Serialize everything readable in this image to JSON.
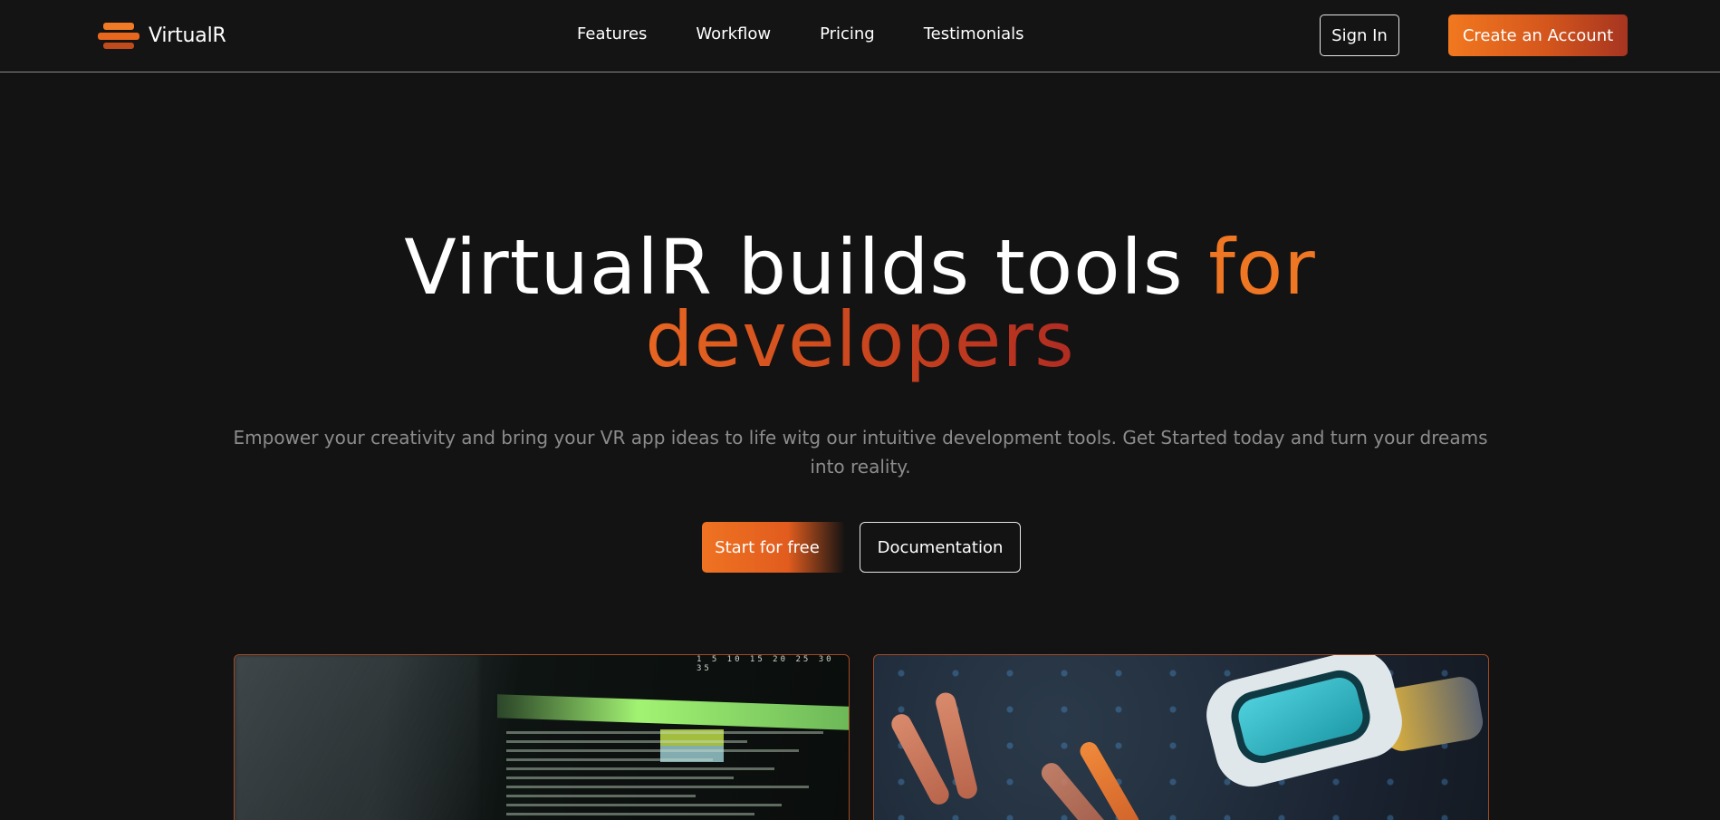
{
  "brand": {
    "name": "VirtualR"
  },
  "nav": {
    "links": [
      "Features",
      "Workflow",
      "Pricing",
      "Testimonials"
    ],
    "sign_in": "Sign In",
    "create_account": "Create an Account"
  },
  "hero": {
    "title_main": "VirtualR builds tools ",
    "title_accent_1": "for",
    "title_accent_2": "developers",
    "subtitle": "Empower your creativity and bring your VR app ideas to life witg our intuitive development tools. Get Started today and turn your dreams into reality.",
    "cta_primary": "Start for free",
    "cta_secondary": "Documentation"
  },
  "colors": {
    "background": "#131313",
    "accent_orange": "#ef7623",
    "accent_red": "#b02c22",
    "subtitle_gray": "#8c8c8c"
  },
  "images": {
    "left_card": "terminal-code-image",
    "right_card": "vr-headset-image"
  },
  "terminal": {
    "header_numbers": "1 5 10 15 20 25 30 35"
  }
}
